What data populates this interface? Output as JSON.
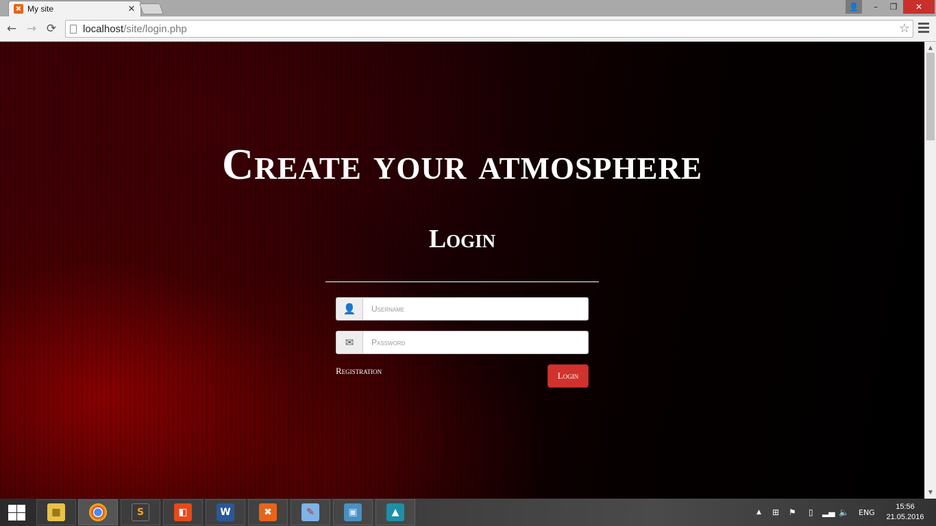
{
  "browser": {
    "tab_title": "My site",
    "tab_close": "✕",
    "url_host": "localhost",
    "url_path": "/site/login.php",
    "nav": {
      "back": "←",
      "forward": "→",
      "reload": "⟳"
    },
    "window": {
      "minimize": "–",
      "maximize": "❐",
      "close": "✕",
      "user": "👤"
    },
    "star": "☆"
  },
  "page": {
    "headline": "Create your atmosphere",
    "login_title": "Login",
    "username_placeholder": "Username",
    "password_placeholder": "Password",
    "registration_link": "Registration",
    "login_button": "Login"
  },
  "taskbar": {
    "apps": [
      {
        "name": "file-explorer",
        "glyph": "▦"
      },
      {
        "name": "chrome",
        "glyph": "◉"
      },
      {
        "name": "sublime-text",
        "glyph": "S"
      },
      {
        "name": "office",
        "glyph": "◧"
      },
      {
        "name": "word",
        "glyph": "W"
      },
      {
        "name": "xampp",
        "glyph": "✖"
      },
      {
        "name": "paint",
        "glyph": "✎"
      },
      {
        "name": "photos",
        "glyph": "▣"
      },
      {
        "name": "image-viewer",
        "glyph": "▲"
      }
    ],
    "tray": {
      "overflow": "▲",
      "lang": "ENG"
    },
    "time": "15:56",
    "date": "21.05.2016"
  },
  "colors": {
    "accent_red": "#d2322d",
    "close_red": "#c9302c",
    "xampp_orange": "#e8641b"
  }
}
